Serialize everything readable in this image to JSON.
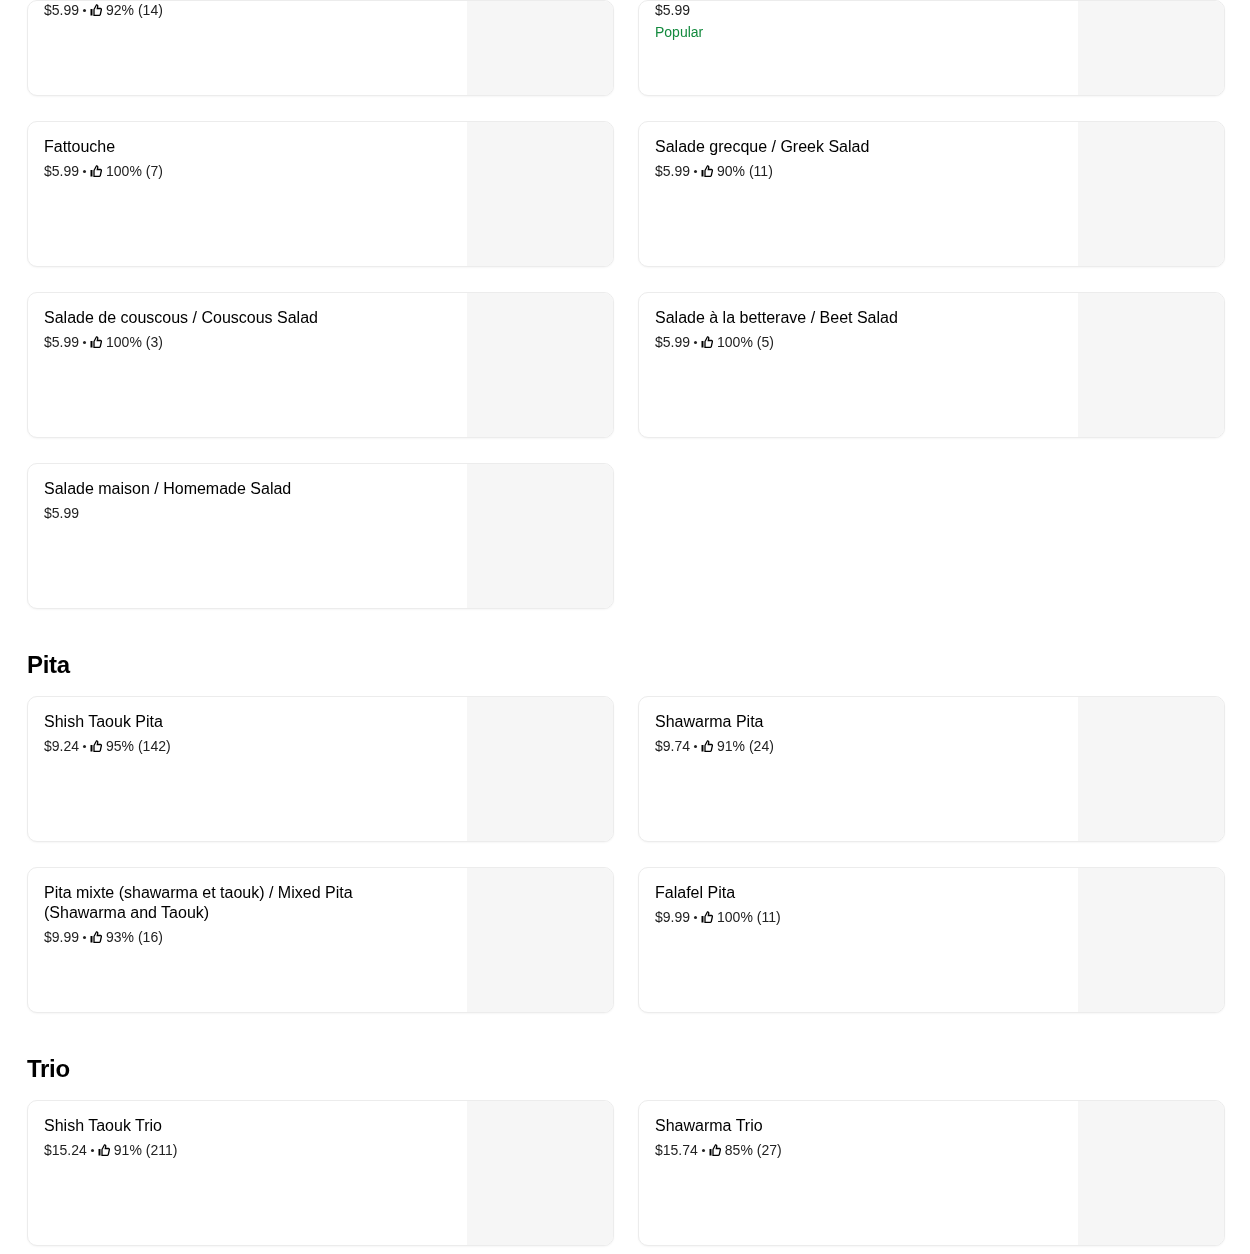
{
  "sections": [
    {
      "items": [
        {
          "price": "$5.99",
          "rating": "92% (14)"
        },
        {
          "price": "$5.99",
          "badge": "Popular"
        }
      ]
    },
    {
      "items": [
        {
          "name": "Fattouche",
          "price": "$5.99",
          "rating": "100% (7)"
        },
        {
          "name": "Salade grecque / Greek Salad",
          "price": "$5.99",
          "rating": "90% (11)"
        },
        {
          "name": "Salade de couscous / Couscous Salad",
          "price": "$5.99",
          "rating": "100% (3)"
        },
        {
          "name": "Salade à la betterave / Beet Salad",
          "price": "$5.99",
          "rating": "100% (5)"
        },
        {
          "name": "Salade maison / Homemade Salad",
          "price": "$5.99"
        }
      ]
    },
    {
      "title": "Pita",
      "items": [
        {
          "name": "Shish Taouk Pita",
          "price": "$9.24",
          "rating": "95% (142)"
        },
        {
          "name": "Shawarma Pita",
          "price": "$9.74",
          "rating": "91% (24)"
        },
        {
          "name": "Pita mixte (shawarma et taouk) / Mixed Pita (Shawarma and Taouk)",
          "price": "$9.99",
          "rating": "93% (16)"
        },
        {
          "name": "Falafel Pita",
          "price": "$9.99",
          "rating": "100% (11)"
        }
      ]
    },
    {
      "title": "Trio",
      "items": [
        {
          "name": "Shish Taouk Trio",
          "price": "$15.24",
          "rating": "91% (211)"
        },
        {
          "name": "Shawarma Trio",
          "price": "$15.74",
          "rating": "85% (27)"
        }
      ]
    }
  ]
}
